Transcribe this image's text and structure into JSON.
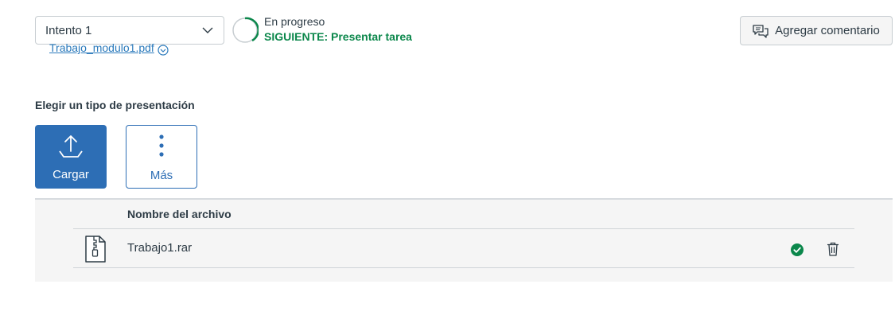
{
  "attempt": {
    "selected": "Intento 1"
  },
  "progress": {
    "status": "En progreso",
    "next_step": "SIGUIENTE: Presentar tarea",
    "accent_color": "#0b874b"
  },
  "comment_button": {
    "label": "Agregar comentario"
  },
  "previous_file": {
    "name": "Trabajo_modulo1.pdf"
  },
  "submission_type": {
    "heading": "Elegir un tipo de presentación",
    "options": [
      {
        "label": "Cargar",
        "icon": "upload-icon",
        "selected": true
      },
      {
        "label": "Más",
        "icon": "more-vertical-icon",
        "selected": false
      }
    ]
  },
  "files_table": {
    "header": "Nombre del archivo",
    "rows": [
      {
        "name": "Trabajo1.rar",
        "file_icon": "zip-file-icon",
        "status_icon": "check-circle-icon",
        "action_icon": "trash-icon"
      }
    ]
  },
  "colors": {
    "primary": "#2d6eb5",
    "success": "#0b874b",
    "link": "#2b7abc"
  }
}
